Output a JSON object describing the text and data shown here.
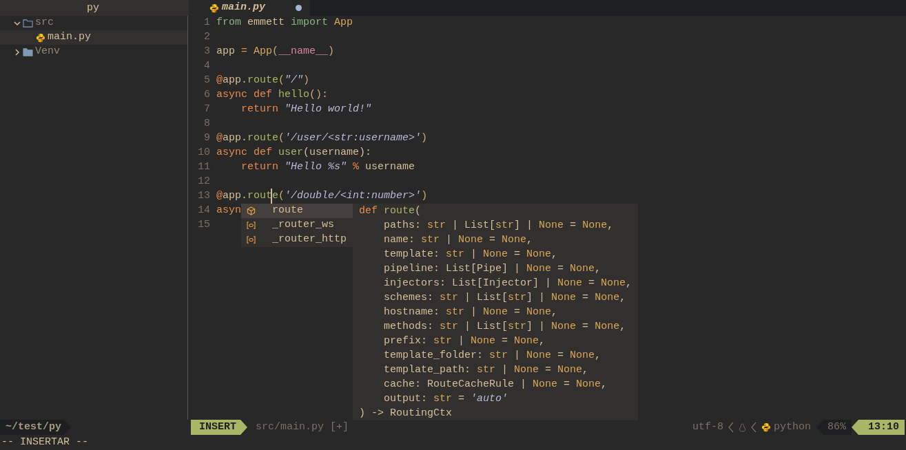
{
  "sidebar": {
    "title": "py",
    "tree": [
      {
        "label": "src",
        "kind": "folder",
        "expanded": true,
        "selected": false,
        "children": [
          {
            "label": "main.py",
            "kind": "python-file",
            "selected": true
          }
        ]
      },
      {
        "label": "Venv",
        "kind": "folder",
        "expanded": false,
        "selected": false
      }
    ]
  },
  "tabs": [
    {
      "label": "main.py",
      "selected": true,
      "modified": true
    }
  ],
  "editor": {
    "lines": [
      {
        "number": "1",
        "tokens": [
          {
            "text": "from ",
            "kind": "import"
          },
          {
            "text": "emmett ",
            "kind": "plain"
          },
          {
            "text": "import ",
            "kind": "import"
          },
          {
            "text": "App",
            "kind": "type"
          }
        ]
      },
      {
        "number": "2"
      },
      {
        "number": "3",
        "tokens": [
          {
            "text": "app ",
            "kind": "plain"
          },
          {
            "text": "= ",
            "kind": "operator"
          },
          {
            "text": "App",
            "kind": "type"
          },
          {
            "text": "(",
            "kind": "punct"
          },
          {
            "text": "__name__",
            "kind": "special"
          },
          {
            "text": ")",
            "kind": "punct"
          }
        ]
      },
      {
        "number": "4"
      },
      {
        "number": "5",
        "tokens": [
          {
            "text": "@",
            "kind": "operator"
          },
          {
            "text": "app.",
            "kind": "plain"
          },
          {
            "text": "route",
            "kind": "func"
          },
          {
            "text": "(",
            "kind": "punct"
          },
          {
            "text": "\"/\"",
            "kind": "string"
          },
          {
            "text": ")",
            "kind": "punct"
          }
        ]
      },
      {
        "number": "6",
        "tokens": [
          {
            "text": "async def ",
            "kind": "keyword"
          },
          {
            "text": "hello",
            "kind": "func"
          },
          {
            "text": "():",
            "kind": "punct"
          }
        ]
      },
      {
        "number": "7",
        "tokens": [
          {
            "text": "    return ",
            "kind": "keyword"
          },
          {
            "text": "\"Hello world!\"",
            "kind": "string"
          }
        ]
      },
      {
        "number": "8"
      },
      {
        "number": "9",
        "tokens": [
          {
            "text": "@",
            "kind": "operator"
          },
          {
            "text": "app.",
            "kind": "plain"
          },
          {
            "text": "route",
            "kind": "func"
          },
          {
            "text": "(",
            "kind": "punct"
          },
          {
            "text": "'/user/<str:username>'",
            "kind": "string"
          },
          {
            "text": ")",
            "kind": "punct"
          }
        ]
      },
      {
        "number": "10",
        "tokens": [
          {
            "text": "async def ",
            "kind": "keyword"
          },
          {
            "text": "user",
            "kind": "func"
          },
          {
            "text": "(username):",
            "kind": "plain"
          }
        ]
      },
      {
        "number": "11",
        "tokens": [
          {
            "text": "    return ",
            "kind": "keyword"
          },
          {
            "text": "\"Hello %s\" ",
            "kind": "string"
          },
          {
            "text": "% ",
            "kind": "operator"
          },
          {
            "text": "username",
            "kind": "plain"
          }
        ]
      },
      {
        "number": "12"
      },
      {
        "number": "13",
        "tokens": [
          {
            "text": "@",
            "kind": "operator"
          },
          {
            "text": "app.",
            "kind": "plain"
          },
          {
            "text": "rout",
            "kind": "func"
          },
          {
            "text": "e",
            "kind": "func",
            "cursor_before": true
          },
          {
            "text": "(",
            "kind": "punct"
          },
          {
            "text": "'/double/<int:number>'",
            "kind": "string"
          },
          {
            "text": ")",
            "kind": "punct"
          }
        ]
      },
      {
        "number": "14",
        "tokens": [
          {
            "text": "asyn",
            "kind": "keyword"
          }
        ]
      },
      {
        "number": "15"
      }
    ]
  },
  "completion": {
    "items": [
      {
        "label": "route",
        "kind": "class",
        "selected": true
      },
      {
        "label": "_router_ws",
        "kind": "field",
        "selected": false
      },
      {
        "label": "_router_http",
        "kind": "field",
        "selected": false
      }
    ],
    "doc_lines": [
      [
        {
          "text": "def ",
          "kind": "keyword"
        },
        {
          "text": "route",
          "kind": "func"
        },
        {
          "text": "(",
          "kind": "plain"
        }
      ],
      [
        {
          "text": "    paths: ",
          "kind": "plain"
        },
        {
          "text": "str",
          "kind": "type"
        },
        {
          "text": " | List[",
          "kind": "plain"
        },
        {
          "text": "str",
          "kind": "type"
        },
        {
          "text": "] | ",
          "kind": "plain"
        },
        {
          "text": "None",
          "kind": "type"
        },
        {
          "text": " = ",
          "kind": "plain"
        },
        {
          "text": "None",
          "kind": "type"
        },
        {
          "text": ",",
          "kind": "plain"
        }
      ],
      [
        {
          "text": "    name: ",
          "kind": "plain"
        },
        {
          "text": "str",
          "kind": "type"
        },
        {
          "text": " | ",
          "kind": "plain"
        },
        {
          "text": "None",
          "kind": "type"
        },
        {
          "text": " = ",
          "kind": "plain"
        },
        {
          "text": "None",
          "kind": "type"
        },
        {
          "text": ",",
          "kind": "plain"
        }
      ],
      [
        {
          "text": "    template: ",
          "kind": "plain"
        },
        {
          "text": "str",
          "kind": "type"
        },
        {
          "text": " | ",
          "kind": "plain"
        },
        {
          "text": "None",
          "kind": "type"
        },
        {
          "text": " = ",
          "kind": "plain"
        },
        {
          "text": "None",
          "kind": "type"
        },
        {
          "text": ",",
          "kind": "plain"
        }
      ],
      [
        {
          "text": "    pipeline: List[Pipe] | ",
          "kind": "plain"
        },
        {
          "text": "None",
          "kind": "type"
        },
        {
          "text": " = ",
          "kind": "plain"
        },
        {
          "text": "None",
          "kind": "type"
        },
        {
          "text": ",",
          "kind": "plain"
        }
      ],
      [
        {
          "text": "    injectors: List[Injector] | ",
          "kind": "plain"
        },
        {
          "text": "None",
          "kind": "type"
        },
        {
          "text": " = ",
          "kind": "plain"
        },
        {
          "text": "None",
          "kind": "type"
        },
        {
          "text": ",",
          "kind": "plain"
        }
      ],
      [
        {
          "text": "    schemes: ",
          "kind": "plain"
        },
        {
          "text": "str",
          "kind": "type"
        },
        {
          "text": " | List[",
          "kind": "plain"
        },
        {
          "text": "str",
          "kind": "type"
        },
        {
          "text": "] | ",
          "kind": "plain"
        },
        {
          "text": "None",
          "kind": "type"
        },
        {
          "text": " = ",
          "kind": "plain"
        },
        {
          "text": "None",
          "kind": "type"
        },
        {
          "text": ",",
          "kind": "plain"
        }
      ],
      [
        {
          "text": "    hostname: ",
          "kind": "plain"
        },
        {
          "text": "str",
          "kind": "type"
        },
        {
          "text": " | ",
          "kind": "plain"
        },
        {
          "text": "None",
          "kind": "type"
        },
        {
          "text": " = ",
          "kind": "plain"
        },
        {
          "text": "None",
          "kind": "type"
        },
        {
          "text": ",",
          "kind": "plain"
        }
      ],
      [
        {
          "text": "    methods: ",
          "kind": "plain"
        },
        {
          "text": "str",
          "kind": "type"
        },
        {
          "text": " | List[",
          "kind": "plain"
        },
        {
          "text": "str",
          "kind": "type"
        },
        {
          "text": "] | ",
          "kind": "plain"
        },
        {
          "text": "None",
          "kind": "type"
        },
        {
          "text": " = ",
          "kind": "plain"
        },
        {
          "text": "None",
          "kind": "type"
        },
        {
          "text": ",",
          "kind": "plain"
        }
      ],
      [
        {
          "text": "    prefix: ",
          "kind": "plain"
        },
        {
          "text": "str",
          "kind": "type"
        },
        {
          "text": " | ",
          "kind": "plain"
        },
        {
          "text": "None",
          "kind": "type"
        },
        {
          "text": " = ",
          "kind": "plain"
        },
        {
          "text": "None",
          "kind": "type"
        },
        {
          "text": ",",
          "kind": "plain"
        }
      ],
      [
        {
          "text": "    template_folder: ",
          "kind": "plain"
        },
        {
          "text": "str",
          "kind": "type"
        },
        {
          "text": " | ",
          "kind": "plain"
        },
        {
          "text": "None",
          "kind": "type"
        },
        {
          "text": " = ",
          "kind": "plain"
        },
        {
          "text": "None",
          "kind": "type"
        },
        {
          "text": ",",
          "kind": "plain"
        }
      ],
      [
        {
          "text": "    template_path: ",
          "kind": "plain"
        },
        {
          "text": "str",
          "kind": "type"
        },
        {
          "text": " | ",
          "kind": "plain"
        },
        {
          "text": "None",
          "kind": "type"
        },
        {
          "text": " = ",
          "kind": "plain"
        },
        {
          "text": "None",
          "kind": "type"
        },
        {
          "text": ",",
          "kind": "plain"
        }
      ],
      [
        {
          "text": "    cache: RouteCacheRule | ",
          "kind": "plain"
        },
        {
          "text": "None",
          "kind": "type"
        },
        {
          "text": " = ",
          "kind": "plain"
        },
        {
          "text": "None",
          "kind": "type"
        },
        {
          "text": ",",
          "kind": "plain"
        }
      ],
      [
        {
          "text": "    output: ",
          "kind": "plain"
        },
        {
          "text": "str",
          "kind": "type"
        },
        {
          "text": " = ",
          "kind": "plain"
        },
        {
          "text": "'auto'",
          "kind": "string"
        }
      ],
      [
        {
          "text": ") -> RoutingCtx",
          "kind": "plain"
        }
      ]
    ]
  },
  "status_bar": {
    "cwd": "~/test/py",
    "mode": "INSERT",
    "file": "src/main.py [+]",
    "encoding": "utf-8",
    "filetype": "python",
    "percent": "86%",
    "position": "13:10"
  },
  "command_line": "-- INSERTAR --"
}
